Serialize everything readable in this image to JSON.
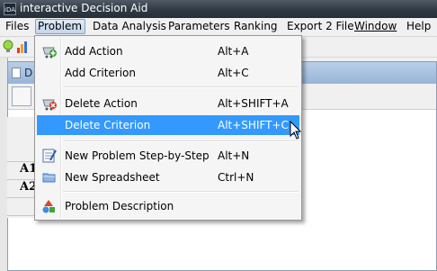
{
  "window": {
    "title": "interactive Decision Aid",
    "app_icon_text": "iDA"
  },
  "menubar": {
    "items": [
      {
        "label": "Files"
      },
      {
        "label": "Problem",
        "open": true
      },
      {
        "label": "Data Analysis"
      },
      {
        "label": "Parameters"
      },
      {
        "label": "Ranking"
      },
      {
        "label": "Export 2 File"
      },
      {
        "label": "Window",
        "underline_first": true
      },
      {
        "label": "Help"
      }
    ]
  },
  "inner_frame": {
    "title": "D",
    "row_labels": [
      "A1",
      "A2"
    ]
  },
  "problem_menu": {
    "items": [
      {
        "label": "Add Action",
        "shortcut": "Alt+A",
        "icon": "add-action-icon"
      },
      {
        "label": "Add Criterion",
        "shortcut": "Alt+C",
        "icon": "none"
      },
      {
        "label": "Delete Action",
        "shortcut": "Alt+SHIFT+A",
        "icon": "delete-action-icon"
      },
      {
        "label": "Delete Criterion",
        "shortcut": "Alt+SHIFT+C",
        "icon": "none",
        "highlighted": true
      },
      {
        "label": "New Problem Step-by-Step",
        "shortcut": "Alt+N",
        "icon": "step-by-step-icon"
      },
      {
        "label": "New Spreadsheet",
        "shortcut": "Ctrl+N",
        "icon": "folder-icon"
      },
      {
        "label": "Problem Description",
        "shortcut": "",
        "icon": "shapes-icon"
      }
    ]
  },
  "colors": {
    "highlight": "#3399ff",
    "titlebar": "#303a44",
    "open_menu_border": "#7da2ce"
  }
}
